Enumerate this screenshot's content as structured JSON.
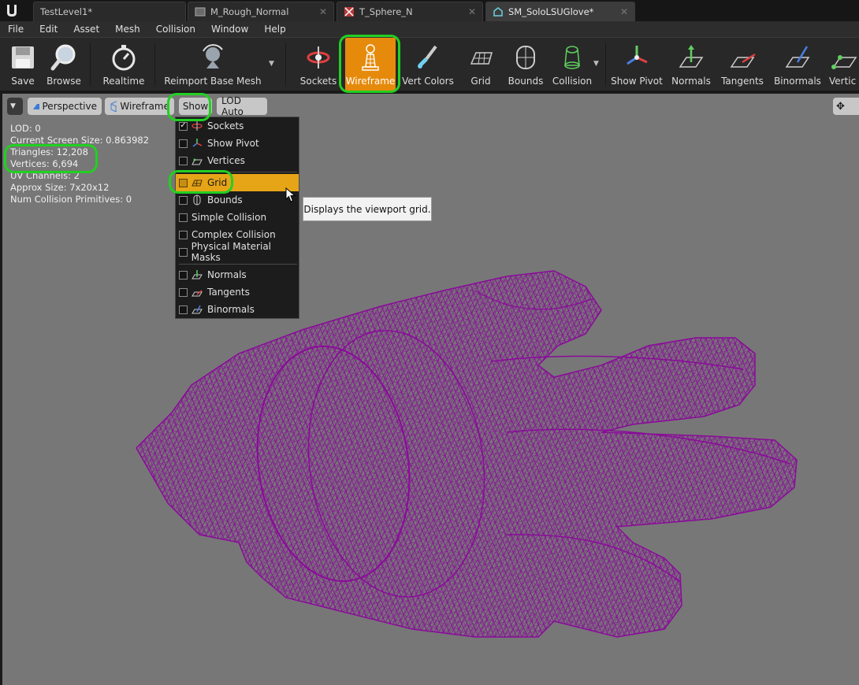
{
  "tabs": [
    {
      "label": "TestLevel1*"
    },
    {
      "label": "M_Rough_Normal"
    },
    {
      "label": "T_Sphere_N"
    },
    {
      "label": "SM_SoloLSUGlove*"
    }
  ],
  "menu": [
    "File",
    "Edit",
    "Asset",
    "Mesh",
    "Collision",
    "Window",
    "Help"
  ],
  "toolbar": {
    "save": "Save",
    "browse": "Browse",
    "realtime": "Realtime",
    "reimport": "Reimport Base Mesh",
    "sockets": "Sockets",
    "wireframe": "Wireframe",
    "vert_colors": "Vert Colors",
    "grid": "Grid",
    "bounds": "Bounds",
    "collision": "Collision",
    "show_pivot": "Show Pivot",
    "normals": "Normals",
    "tangents": "Tangents",
    "binormals": "Binormals",
    "vertices": "Vertic"
  },
  "viewport_bar": {
    "perspective": "Perspective",
    "wireframe": "Wireframe",
    "show": "Show",
    "lod": "LOD Auto"
  },
  "stats": {
    "lod": "LOD:  0",
    "screen_size": "Current Screen Size:  0.863982",
    "triangles": "Triangles:  12,208",
    "vertices": "Vertices:  6,694",
    "uv_channels": "UV Channels:  2",
    "approx_size": "Approx Size: 7x20x12",
    "collision_prims": "Num Collision Primitives:  0"
  },
  "show_menu": {
    "items": [
      {
        "label": "Sockets",
        "checked": true
      },
      {
        "label": "Show Pivot",
        "checked": false
      },
      {
        "label": "Vertices",
        "checked": false
      },
      {
        "label": "Grid",
        "checked": false
      },
      {
        "label": "Bounds",
        "checked": false
      },
      {
        "label": "Simple Collision",
        "checked": false
      },
      {
        "label": "Complex Collision",
        "checked": false
      },
      {
        "label": "Physical Material Masks",
        "checked": false
      },
      {
        "label": "Normals",
        "checked": false
      },
      {
        "label": "Tangents",
        "checked": false
      },
      {
        "label": "Binormals",
        "checked": false
      }
    ]
  },
  "tooltip": "Displays the viewport grid.",
  "colors": {
    "accent": "#e68a0c",
    "highlight_outline": "#22d022",
    "wireframe": "#8a0a9a",
    "viewport_bg": "#777777"
  }
}
